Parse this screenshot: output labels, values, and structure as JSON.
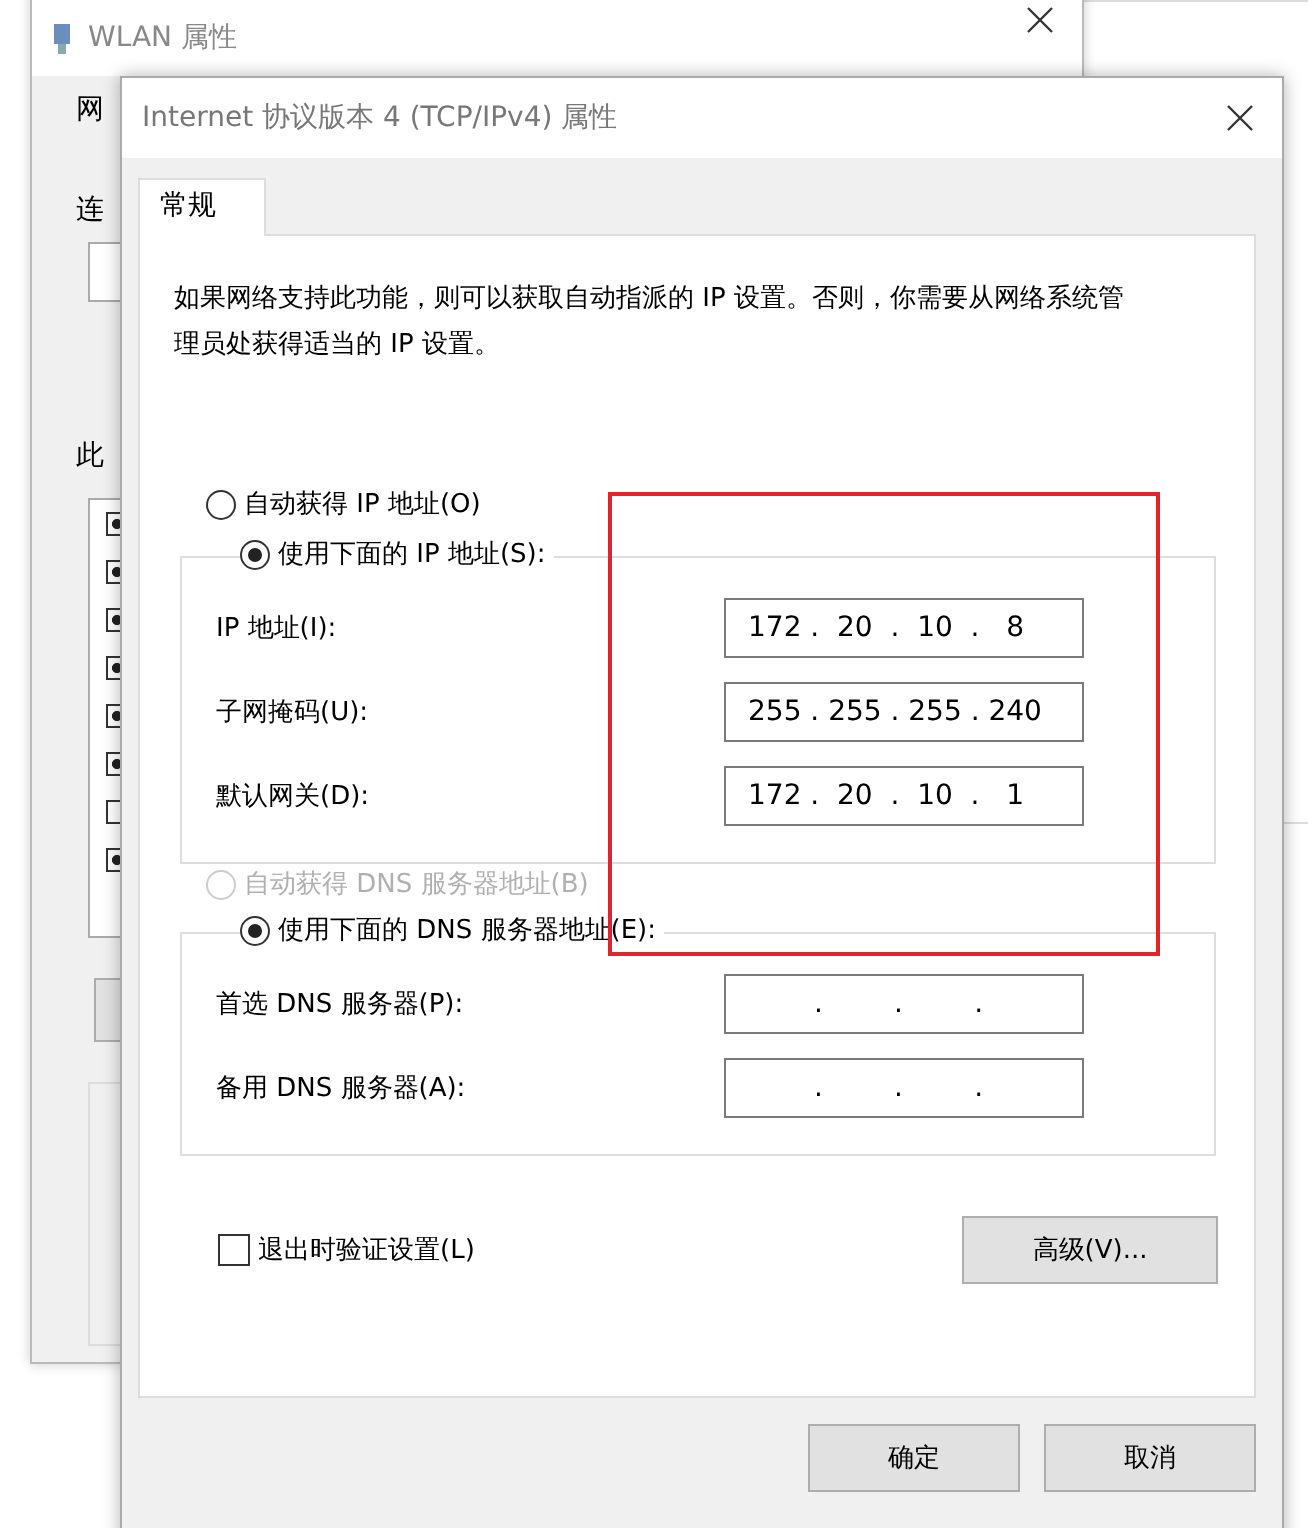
{
  "background_window": {
    "title": "WLAN 属性",
    "labels": [
      "网",
      "连",
      "此"
    ],
    "list_items": [
      {
        "checked": true
      },
      {
        "checked": true
      },
      {
        "checked": true
      },
      {
        "checked": true
      },
      {
        "checked": true
      },
      {
        "checked": true
      },
      {
        "checked": false
      },
      {
        "checked": true
      }
    ]
  },
  "window": {
    "title": "Internet 协议版本 4 (TCP/IPv4) 属性"
  },
  "tabs": [
    {
      "label": "常规",
      "selected": true
    }
  ],
  "description": "如果网络支持此功能，则可以获取自动指派的 IP 设置。否则，你需要从网络系统管理员处获得适当的 IP 设置。",
  "ip_options": [
    {
      "label": "自动获得 IP 地址(O)",
      "selected": false,
      "disabled": false
    },
    {
      "label": "使用下面的 IP 地址(S):",
      "selected": true,
      "disabled": false
    }
  ],
  "ip_fields": [
    {
      "label": "IP 地址(I):",
      "value": "172 .  20  .  10  .   8"
    },
    {
      "label": "子网掩码(U):",
      "value": "255 . 255 . 255 . 240"
    },
    {
      "label": "默认网关(D):",
      "value": "172 .  20  .  10  .   1"
    }
  ],
  "dns_options": [
    {
      "label": "自动获得 DNS 服务器地址(B)",
      "selected": false,
      "disabled": true
    },
    {
      "label": "使用下面的 DNS 服务器地址(E):",
      "selected": true,
      "disabled": false
    }
  ],
  "dns_fields": [
    {
      "label": "首选 DNS 服务器(P):",
      "value": ".        .        ."
    },
    {
      "label": "备用 DNS 服务器(A):",
      "value": ".        .        ."
    }
  ],
  "validate_checkbox": {
    "label": "退出时验证设置(L)",
    "checked": false
  },
  "advanced_button": "高级(V)...",
  "buttons": [
    "确定",
    "取消"
  ],
  "annotation": {
    "kind": "rectangle"
  }
}
